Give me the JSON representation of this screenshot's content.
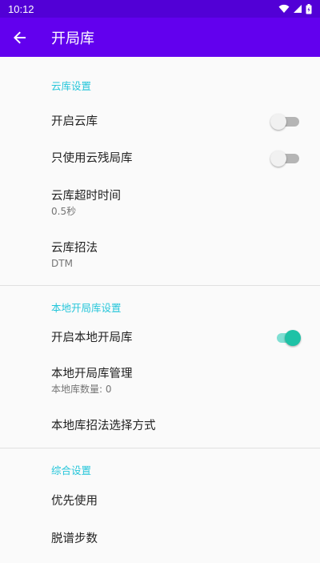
{
  "status_bar": {
    "time": "10:12",
    "icons": [
      "wifi-icon",
      "signal-icon",
      "battery-icon"
    ]
  },
  "app_bar": {
    "title": "开局库",
    "back_icon": "arrow-back-icon"
  },
  "sections": {
    "cloud": {
      "header": "云库设置",
      "enable_cloud": {
        "title": "开启云库",
        "checked": false
      },
      "endgame_only": {
        "title": "只使用云残局库",
        "checked": false
      },
      "timeout": {
        "title": "云库超时时间",
        "summary": "0.5秒"
      },
      "move_method": {
        "title": "云库招法",
        "summary": "DTM"
      }
    },
    "local": {
      "header": "本地开局库设置",
      "enable_local": {
        "title": "开启本地开局库",
        "checked": true
      },
      "manage": {
        "title": "本地开局库管理",
        "summary": "本地库数量: 0"
      },
      "move_select": {
        "title": "本地库招法选择方式"
      }
    },
    "general": {
      "header": "综合设置",
      "priority": {
        "title": "优先使用"
      },
      "out_of_book": {
        "title": "脱谱步数"
      }
    }
  },
  "colors": {
    "status_bar": "#5200d6",
    "app_bar": "#6200ee",
    "accent": "#26c6da",
    "switch_on": "#1ec2a6"
  }
}
